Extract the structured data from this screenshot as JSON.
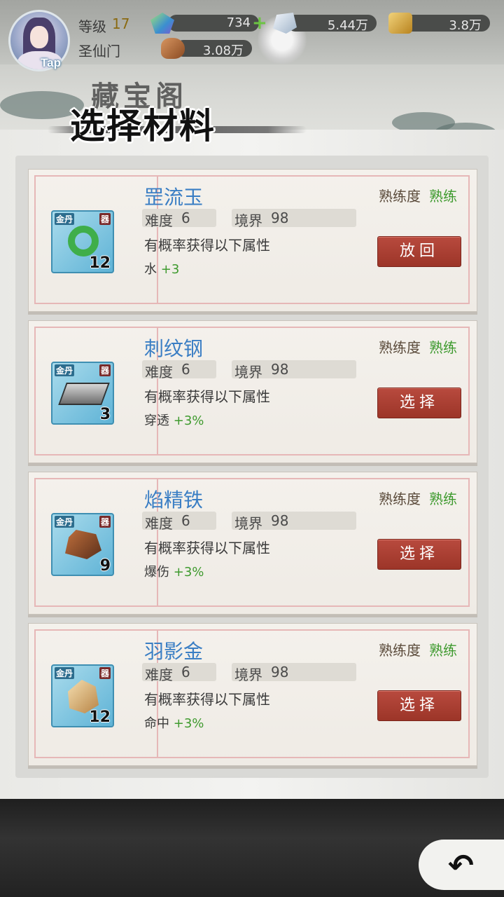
{
  "hud": {
    "level_label": "等级",
    "level_value": "17",
    "sect": "圣仙门",
    "tap": "Tap",
    "resources": {
      "jade": "734",
      "ice": "5.44万",
      "gold": "3.8万",
      "meat": "3.08万"
    }
  },
  "title": {
    "background_text": "藏宝阁",
    "main": "选择材料"
  },
  "labels": {
    "proficiency": "熟练度",
    "difficulty": "难度",
    "realm": "境界",
    "chance": "有概率获得以下属性"
  },
  "materials": [
    {
      "name": "罡流玉",
      "proficiency": "熟练",
      "difficulty": "6",
      "realm": "98",
      "attr_name": "水",
      "attr_bonus": "+3",
      "count": "12",
      "tag_left": "金丹",
      "tag_right": "器",
      "button": "放回",
      "icon": "jade-ring"
    },
    {
      "name": "刺纹钢",
      "proficiency": "熟练",
      "difficulty": "6",
      "realm": "98",
      "attr_name": "穿透",
      "attr_bonus": "+3%",
      "count": "3",
      "tag_left": "金丹",
      "tag_right": "器",
      "button": "选择",
      "icon": "steel-ingot"
    },
    {
      "name": "焰精铁",
      "proficiency": "熟练",
      "difficulty": "6",
      "realm": "98",
      "attr_name": "爆伤",
      "attr_bonus": "+3%",
      "count": "9",
      "tag_left": "金丹",
      "tag_right": "器",
      "button": "选择",
      "icon": "iron-ore"
    },
    {
      "name": "羽影金",
      "proficiency": "熟练",
      "difficulty": "6",
      "realm": "98",
      "attr_name": "命中",
      "attr_bonus": "+3%",
      "count": "12",
      "tag_left": "金丹",
      "tag_right": "器",
      "button": "选择",
      "icon": "gold-ore"
    }
  ],
  "colors": {
    "name_blue": "#3a7ec4",
    "bonus_green": "#3e9a2e",
    "button_red": "#a63b2e"
  }
}
